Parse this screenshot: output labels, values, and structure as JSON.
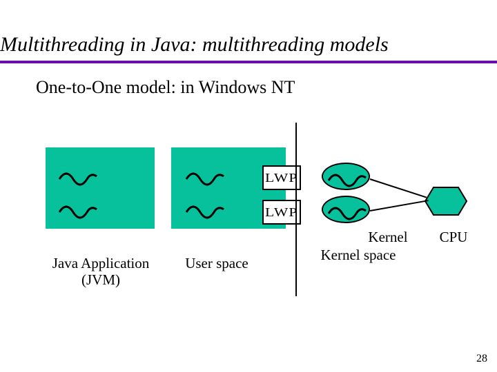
{
  "title": "Multithreading in Java: multithreading models",
  "subtitle": "One-to-One model:  in Windows NT",
  "labels": {
    "lwp": "LWP",
    "java_app": "Java Application\n(JVM)",
    "user_space": "User space",
    "kernel_space": "Kernel space",
    "kernel": "Kernel",
    "cpu": "CPU"
  },
  "page_number": "28",
  "colors": {
    "accent_purple": "#6a0dad",
    "box_green": "#06c19c"
  },
  "chart_data": {
    "type": "diagram",
    "model": "One-to-One threading model (Windows NT)",
    "regions": [
      {
        "name": "Java Application (JVM)",
        "space": "user",
        "threads": 2
      },
      {
        "name": "User process",
        "space": "user",
        "threads": 2,
        "lwp": 2
      },
      {
        "name": "Kernel",
        "space": "kernel",
        "kernel_threads": 2
      }
    ],
    "mappings": [
      {
        "from": "user-thread-1",
        "via": "LWP-1",
        "to": "kernel-thread-1"
      },
      {
        "from": "user-thread-2",
        "via": "LWP-2",
        "to": "kernel-thread-2"
      }
    ],
    "cpu_count": 1,
    "kernel_thread_to_cpu": [
      {
        "kernel_thread": "kernel-thread-1",
        "cpu": "CPU-1"
      },
      {
        "kernel_thread": "kernel-thread-2",
        "cpu": "CPU-1"
      }
    ],
    "boundary": "vertical line separates User space (left) from Kernel space (right)"
  }
}
